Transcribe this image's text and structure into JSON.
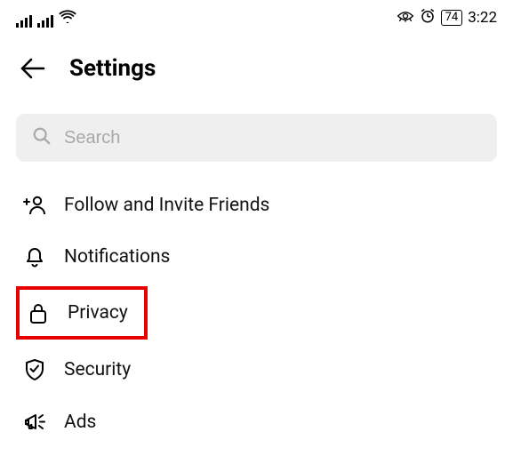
{
  "status_bar": {
    "battery_percent": "74",
    "time": "3:22"
  },
  "header": {
    "title": "Settings"
  },
  "search": {
    "placeholder": "Search"
  },
  "menu": {
    "follow_invite": "Follow and Invite Friends",
    "notifications": "Notifications",
    "privacy": "Privacy",
    "security": "Security",
    "ads": "Ads"
  }
}
